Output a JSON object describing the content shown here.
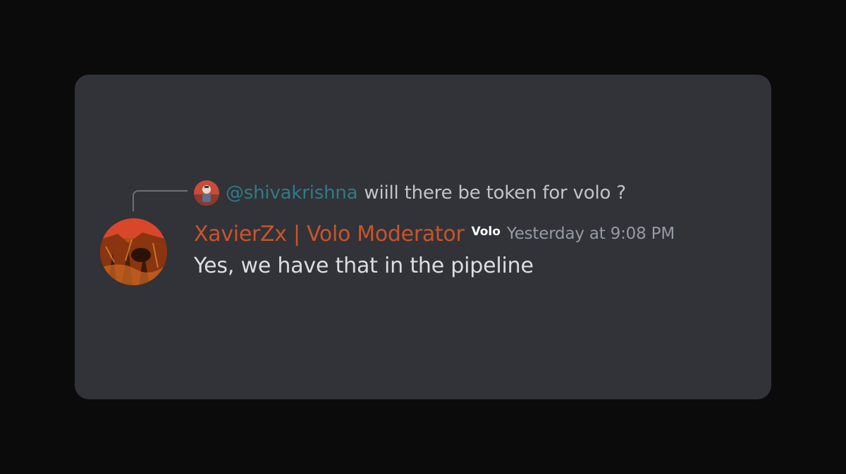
{
  "reply": {
    "mention": "@shivakrishna",
    "text": "wiill there be token for volo ?"
  },
  "author": {
    "name": "XavierZx | Volo Moderator",
    "tag": "Volo",
    "timestamp": "Yesterday at 9:08 PM",
    "name_color": "#c9542a"
  },
  "message": {
    "text": "Yes, we have that in the pipeline"
  },
  "colors": {
    "background": "#0b0b0c",
    "card": "#313338",
    "mention": "#2e7c86",
    "body_text": "#dbdee1",
    "muted_text": "#949ba4"
  }
}
